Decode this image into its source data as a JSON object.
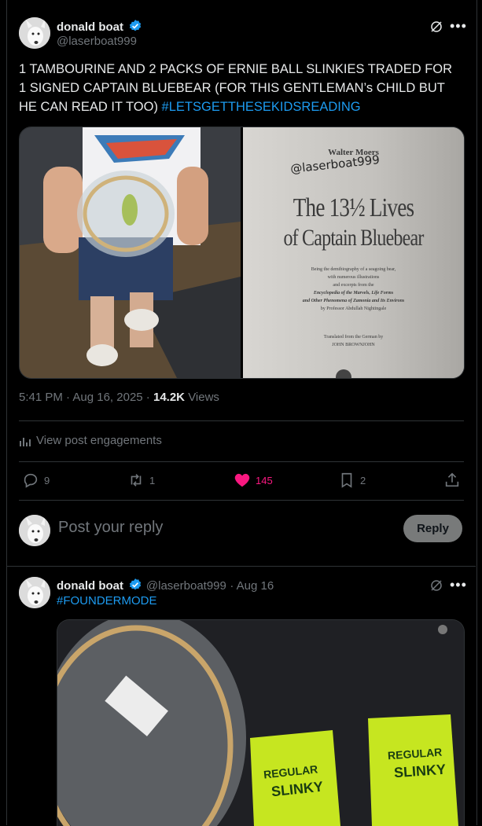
{
  "post": {
    "author_name": "donald boat",
    "author_handle": "@laserboat999",
    "text_main": "1 TAMBOURINE AND 2 PACKS OF ERNIE BALL SLINKIES TRADED FOR 1 SIGNED CAPTAIN BLUEBEAR (FOR THIS GENTLEMAN’s CHILD BUT HE CAN READ IT TOO) ",
    "hashtag": "#LETSGETTHESEKIDSREADING",
    "book": {
      "author": "Walter Moers",
      "signature": "@laserboat999",
      "title_line1": "The 13½ Lives",
      "title_line2": "of Captain Bluebear",
      "desc1": "Being the demibiography of a seagoing bear,",
      "desc2": "with numerous illustrations",
      "desc3": "and excerpts from the",
      "desc4": "Encyclopedia of the Marvels, Life Forms",
      "desc5": "and Other Phenomena of Zamonia and Its Environs",
      "desc6": "by Professor Abdullah Nightingale",
      "trans1": "Translated from the German by",
      "trans2": "JOHN BROWNJOHN"
    },
    "time": "5:41 PM",
    "date": "Aug 16, 2025",
    "views_count": "14.2K",
    "views_label": "Views",
    "engagements_label": "View post engagements",
    "replies": "9",
    "reposts": "1",
    "likes": "145",
    "bookmarks": "2"
  },
  "reply_box": {
    "placeholder": "Post your reply",
    "button_label": "Reply"
  },
  "reply_post": {
    "author_name": "donald boat",
    "author_handle": "@laserboat999",
    "date": "Aug 16",
    "hashtag": "#FOUNDERMODE",
    "pack_text1": "REGULAR",
    "pack_text2": "SLINKY"
  },
  "colors": {
    "accent": "#1d9bf0",
    "like": "#f91880",
    "muted": "#71767b",
    "slinky_green": "#c6e620"
  }
}
